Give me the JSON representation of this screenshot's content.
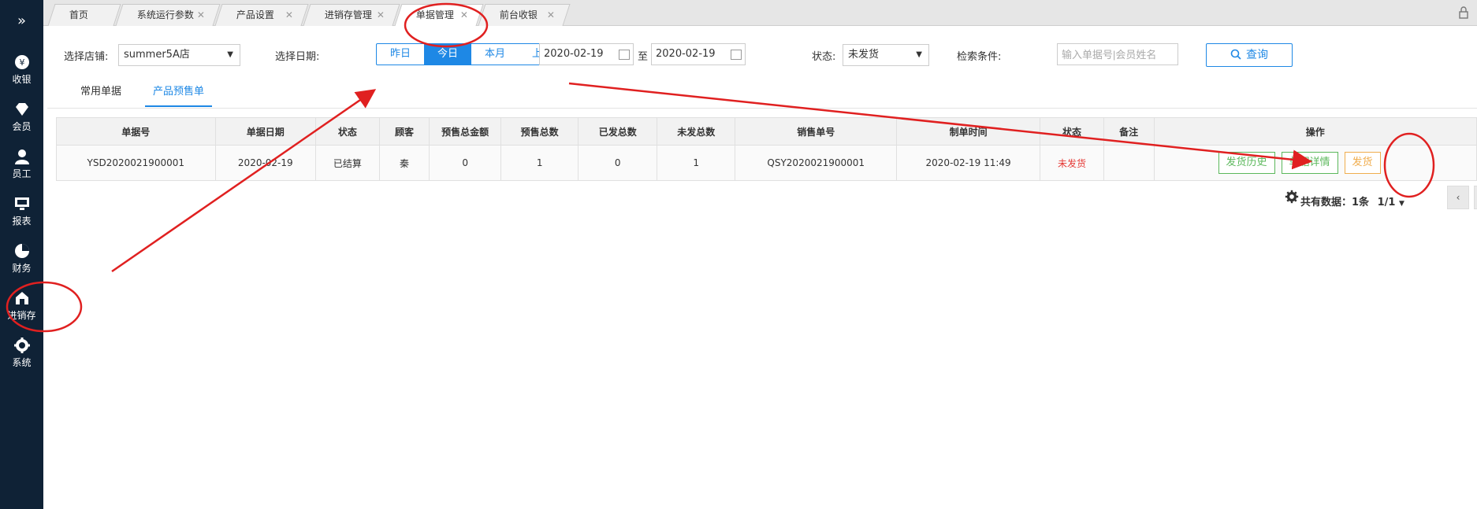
{
  "sidebar": {
    "toggle_icon": "double-chevron-right-icon",
    "items": [
      {
        "label": "收银",
        "icon": "yuan-icon"
      },
      {
        "label": "会员",
        "icon": "diamond-icon"
      },
      {
        "label": "员工",
        "icon": "person-icon"
      },
      {
        "label": "报表",
        "icon": "monitor-icon"
      },
      {
        "label": "财务",
        "icon": "pie-chart-icon"
      },
      {
        "label": "进销存",
        "icon": "warehouse-icon"
      },
      {
        "label": "系统",
        "icon": "gear-icon"
      }
    ]
  },
  "tabs": [
    {
      "label": "首页",
      "closable": false
    },
    {
      "label": "系统运行参数",
      "closable": true
    },
    {
      "label": "产品设置",
      "closable": true
    },
    {
      "label": "进销存管理",
      "closable": true
    },
    {
      "label": "单据管理",
      "closable": true,
      "active": true
    },
    {
      "label": "前台收银",
      "closable": true
    }
  ],
  "filters": {
    "store_label": "选择店铺:",
    "store_value": "summer5A店",
    "date_label": "选择日期:",
    "date_ranges": [
      "昨日",
      "今日",
      "本月",
      "上月"
    ],
    "date_range_selected": "今日",
    "date_from": "2020-02-19",
    "date_sep": "至",
    "date_to": "2020-02-19",
    "status_label": "状态:",
    "status_value": "未发货",
    "search_label": "检索条件:",
    "search_placeholder": "输入单据号|会员姓名",
    "query_button": "查询"
  },
  "subtabs": [
    {
      "label": "常用单据"
    },
    {
      "label": "产品预售单",
      "active": true
    }
  ],
  "table": {
    "headers": [
      "单据号",
      "单据日期",
      "状态",
      "顾客",
      "预售总金额",
      "预售总数",
      "已发总数",
      "未发总数",
      "销售单号",
      "制单时间",
      "状态",
      "备注",
      "操作"
    ],
    "rows": [
      {
        "doc_no": "YSD2020021900001",
        "doc_date": "2020-02-19",
        "state": "已结算",
        "customer": "秦",
        "presale_amount": "0",
        "presale_total": "1",
        "shipped_total": "0",
        "unshipped_total": "1",
        "sales_no": "QSY2020021900001",
        "created_time": "2020-02-19 11:49",
        "ship_status": "未发货",
        "remark": "",
        "actions": [
          "发货历史",
          "单据详情",
          "发货"
        ]
      }
    ]
  },
  "pager": {
    "total_text": "共有数据：1条",
    "page_text": "1/1",
    "prev_icon": "chevron-left-icon"
  },
  "colors": {
    "sidebar_bg": "#0f2236",
    "accent": "#1e88e5",
    "green": "#5cb85c",
    "orange": "#f0ad4e",
    "annotation_red": "#e02020"
  }
}
